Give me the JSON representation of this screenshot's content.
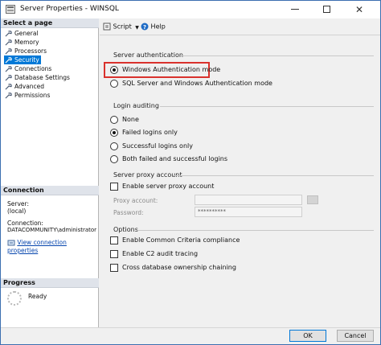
{
  "window": {
    "title": "Server Properties - WINSQL"
  },
  "left_panel": {
    "select_page_header": "Select a page",
    "pages": [
      {
        "label": "General",
        "selected": false
      },
      {
        "label": "Memory",
        "selected": false
      },
      {
        "label": "Processors",
        "selected": false
      },
      {
        "label": "Security",
        "selected": true
      },
      {
        "label": "Connections",
        "selected": false
      },
      {
        "label": "Database Settings",
        "selected": false
      },
      {
        "label": "Advanced",
        "selected": false
      },
      {
        "label": "Permissions",
        "selected": false
      }
    ],
    "connection_header": "Connection",
    "server_label": "Server:",
    "server_value": "(local)",
    "connection_label": "Connection:",
    "connection_value": "DATACOMMUNITY\\administrator",
    "view_connection_link": "View connection properties",
    "progress_header": "Progress",
    "progress_status": "Ready"
  },
  "toolbar": {
    "script_label": "Script",
    "help_label": "Help"
  },
  "server_auth": {
    "title": "Server authentication",
    "options": [
      {
        "label": "Windows Authentication mode",
        "selected": true
      },
      {
        "label": "SQL Server and Windows Authentication mode",
        "selected": false
      }
    ]
  },
  "login_auditing": {
    "title": "Login auditing",
    "options": [
      {
        "label": "None",
        "selected": false
      },
      {
        "label": "Failed logins only",
        "selected": true
      },
      {
        "label": "Successful logins only",
        "selected": false
      },
      {
        "label": "Both failed and successful logins",
        "selected": false
      }
    ]
  },
  "proxy": {
    "title": "Server proxy account",
    "enable_label": "Enable server proxy account",
    "enabled": false,
    "proxy_account_label": "Proxy account:",
    "proxy_account_value": "",
    "password_label": "Password:",
    "password_value": "**********"
  },
  "options": {
    "title": "Options",
    "items": [
      {
        "label": "Enable Common Criteria compliance",
        "checked": false
      },
      {
        "label": "Enable C2 audit tracing",
        "checked": false
      },
      {
        "label": "Cross database ownership chaining",
        "checked": false
      }
    ]
  },
  "buttons": {
    "ok": "OK",
    "cancel": "Cancel"
  },
  "colors": {
    "selection": "#0078d7",
    "highlight_box": "#d9322d",
    "link": "#0645ad"
  },
  "icons": [
    "app-icon",
    "wrench-icon",
    "script-icon",
    "dropdown-arrow-icon",
    "help-icon",
    "connection-icon",
    "progress-spinner-icon"
  ]
}
